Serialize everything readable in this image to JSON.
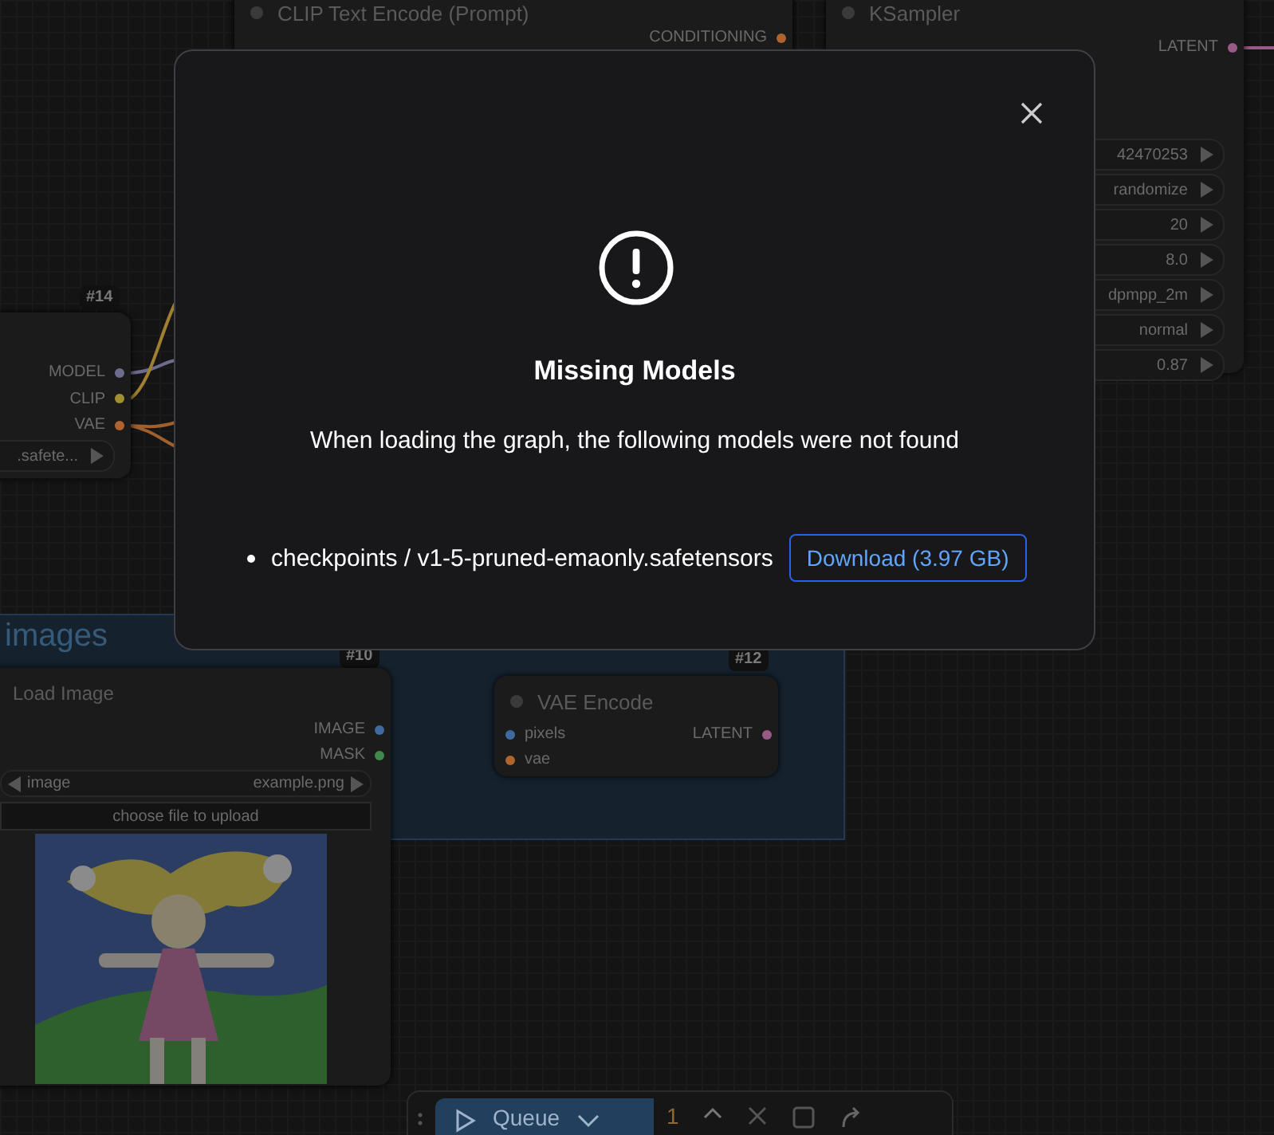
{
  "clip_text_encode": {
    "title": "CLIP Text Encode (Prompt)",
    "output": {
      "label": "CONDITIONING",
      "color": "#b0642d"
    }
  },
  "ksampler": {
    "title": "KSampler",
    "output": {
      "label": "LATENT",
      "color": "#9a5a88"
    },
    "widgets": [
      "42470253",
      "randomize",
      "20",
      "8.0",
      "dpmpp_2m",
      "normal",
      "0.87"
    ]
  },
  "checkpoint_loader": {
    "badge": "#14",
    "outputs": [
      {
        "label": "MODEL",
        "color": "#6c6c8c"
      },
      {
        "label": "CLIP",
        "color": "#a09030"
      },
      {
        "label": "VAE",
        "color": "#b0642d"
      }
    ],
    "widget": ".safete..."
  },
  "group": {
    "title": "images"
  },
  "load_image": {
    "badge": "#10",
    "title": "Load Image",
    "outputs": [
      {
        "label": "IMAGE",
        "color": "#3f6aa0"
      },
      {
        "label": "MASK",
        "color": "#3f8a4a"
      }
    ],
    "combo_label": "image",
    "combo_value": "example.png",
    "upload": "choose file to upload"
  },
  "vae_encode": {
    "badge": "#12",
    "title": "VAE Encode",
    "inputs": [
      {
        "label": "pixels",
        "color": "#3f6aa0"
      },
      {
        "label": "vae",
        "color": "#b0642d"
      }
    ],
    "output": {
      "label": "LATENT",
      "color": "#9a5a88"
    }
  },
  "queue_bar": {
    "label": "Queue",
    "count": "1"
  },
  "dialog": {
    "title": "Missing Models",
    "message": "When loading the graph, the following models were not found",
    "models": [
      {
        "path": "checkpoints / v1-5-pruned-emaonly.safetensors",
        "action": "Download (3.97 GB)"
      }
    ]
  }
}
